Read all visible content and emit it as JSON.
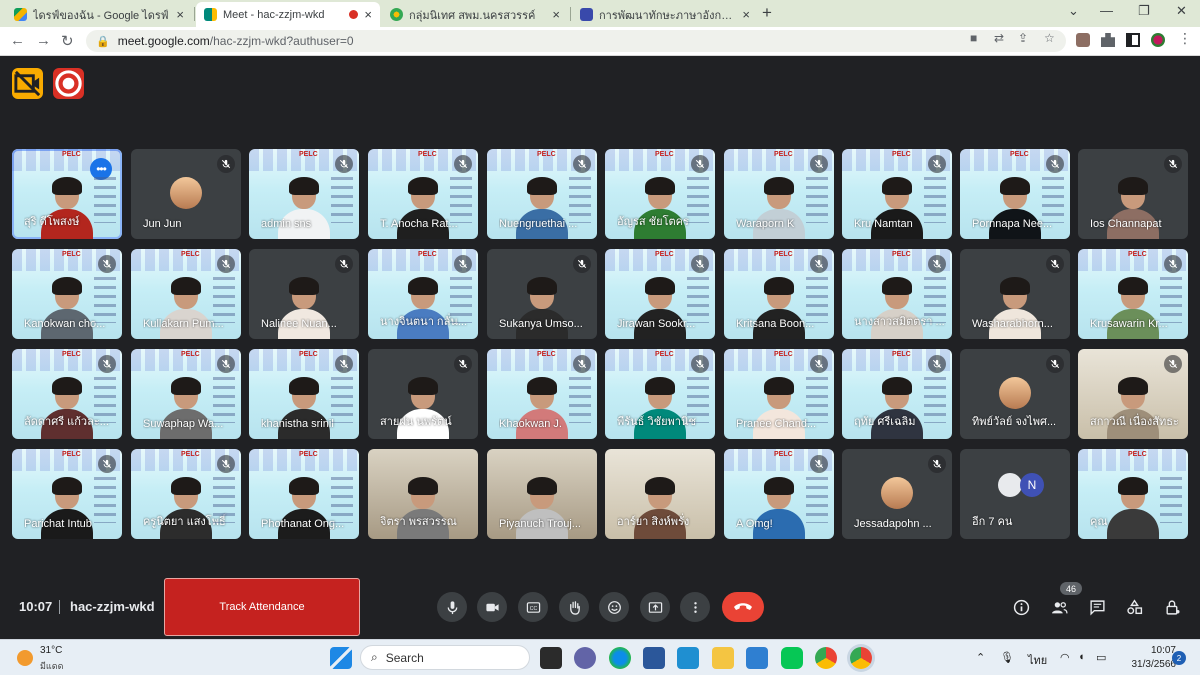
{
  "browser": {
    "tabs": [
      {
        "title": "ไดรฟ์ของฉัน - Google ไดรฟ์",
        "color": "#4285f4"
      },
      {
        "title": "Meet - hac-zzjm-wkd",
        "color": "#00897b"
      },
      {
        "title": "กลุ่มนิเทศ สพม.นครสวรรค์",
        "color": "#34a853"
      },
      {
        "title": "การพัฒนาทักษะภาษาอังกฤษ English",
        "color": "#3949ab"
      }
    ],
    "new_tab": "+",
    "url_host": "meet.google.com",
    "url_path": "/hac-zzjm-wkd?authuser=0"
  },
  "meeting": {
    "code": "hac-zzjm-wkd",
    "time": "10:07",
    "track_attendance": "Track Attendance",
    "people_count": "46",
    "tiles": [
      {
        "name": "สุริ ดีโพสงษ์",
        "kind": "slide",
        "mute": false,
        "dots": true,
        "selected": true,
        "body": "#b3261e"
      },
      {
        "name": "Jun Jun",
        "kind": "dark",
        "mute": true,
        "avatar": true
      },
      {
        "name": "admin sns",
        "kind": "slide",
        "mute": true,
        "body": "#f1f3f4"
      },
      {
        "name": "T. Anocha Rat...",
        "kind": "slide",
        "mute": true,
        "body": "#1f1f1f"
      },
      {
        "name": "Nuengruethai ...",
        "kind": "slide",
        "mute": true,
        "body": "#3a6ea5"
      },
      {
        "name": "อัญรส ชัยโตคร",
        "kind": "slide",
        "mute": true,
        "body": "#2e7d32"
      },
      {
        "name": "Waraporn K",
        "kind": "slide",
        "mute": true,
        "body": "#c2cfd6"
      },
      {
        "name": "Kru Namtan",
        "kind": "slide",
        "mute": true,
        "body": "#1a1a1a"
      },
      {
        "name": "Pornnapa Nee...",
        "kind": "slide",
        "mute": true,
        "body": "#101418"
      },
      {
        "name": "Ios Channapat",
        "kind": "dark",
        "mute": true,
        "body": "#8d6e63"
      },
      {
        "name": "Kanokwan cho...",
        "kind": "slide",
        "mute": true,
        "body": "#5d6770"
      },
      {
        "name": "Kullakarn Pum...",
        "kind": "slide",
        "mute": true,
        "body": "#d9d4cf"
      },
      {
        "name": "Nalinee Nuan...",
        "kind": "dark",
        "mute": true,
        "body": "#f0e8e0"
      },
      {
        "name": "นางจินตนา กลั่น...",
        "kind": "slide",
        "mute": true,
        "body": "#4a7cc1"
      },
      {
        "name": "Sukanya Umso...",
        "kind": "dark",
        "mute": true,
        "body": "#2b2b2b"
      },
      {
        "name": "Jirawan Sookr...",
        "kind": "slide",
        "mute": true,
        "body": "#222222"
      },
      {
        "name": "Kritsana Boon...",
        "kind": "slide",
        "mute": true,
        "body": "#222222"
      },
      {
        "name": "นางสาวสมิตตรา ...",
        "kind": "slide",
        "mute": true,
        "body": "#d6d0c8"
      },
      {
        "name": "Washarabhorn...",
        "kind": "dark",
        "mute": true,
        "body": "#efe6dc"
      },
      {
        "name": "Krusawarin Kr...",
        "kind": "slide",
        "mute": true,
        "body": "#6b8f5a"
      },
      {
        "name": "ลัดดาศรี แก้วละ...",
        "kind": "slide",
        "mute": true,
        "body": "#5f2f2f"
      },
      {
        "name": "Suwaphap Wa...",
        "kind": "slide",
        "mute": true,
        "body": "#6d6d6d"
      },
      {
        "name": "khanistha srinil",
        "kind": "slide",
        "mute": true,
        "body": "#2b2b2b"
      },
      {
        "name": "สายฝน นพรัตน์",
        "kind": "dark",
        "mute": true,
        "body": "#ffffff"
      },
      {
        "name": "Khaokwan J.",
        "kind": "slide",
        "mute": true,
        "body": "#d27a7a"
      },
      {
        "name": "พีรันธ์ วิชัยพานิช",
        "kind": "slide",
        "mute": true,
        "body": "#00897b"
      },
      {
        "name": "Pranee Chand...",
        "kind": "slide",
        "mute": true,
        "body": "#f3e6dc"
      },
      {
        "name": "ฤทัย ศรีเฉลิม",
        "kind": "slide",
        "mute": true,
        "body": "#2f3440"
      },
      {
        "name": "ทิพย์วัลย์ จงไพศ...",
        "kind": "dark",
        "mute": true,
        "avatar": true
      },
      {
        "name": "สกาวณี เนื่องสัทธะ",
        "kind": "warm",
        "mute": true,
        "body": "#9e8f7a"
      },
      {
        "name": "Parichat Intub",
        "kind": "slide",
        "mute": true,
        "body": "#1a1a1a"
      },
      {
        "name": "ครูนิตยา แสงโพธิ์",
        "kind": "slide",
        "mute": true,
        "body": "#2c2c2c"
      },
      {
        "name": "Phothanat Ong...",
        "kind": "slide",
        "mute": false,
        "body": "#1c1c1c"
      },
      {
        "name": "จิตรา พรสวรรณ",
        "kind": "photo",
        "mute": false,
        "body": "#7a7a7a"
      },
      {
        "name": "Piyanuch Trouj...",
        "kind": "photo",
        "mute": false,
        "body": "#bfbfbf"
      },
      {
        "name": "อาร์ยา สิงห์พรั่ง",
        "kind": "warm",
        "mute": false,
        "body": "#6e4b3a"
      },
      {
        "name": "A Omg!",
        "kind": "slide",
        "mute": true,
        "body": "#2b6cb0"
      },
      {
        "name": "Jessadapohn ...",
        "kind": "dark",
        "mute": true,
        "avatar": true
      },
      {
        "name": "อีก 7 คน",
        "kind": "dark",
        "mute": false,
        "others": true
      },
      {
        "name": "คุณ",
        "kind": "slide",
        "mute": false,
        "body": "#3a3a3a"
      }
    ]
  },
  "taskbar": {
    "temp": "31°C",
    "weather": "มีแดด",
    "search_label": "Search",
    "lang": "ไทย",
    "time": "10:07",
    "date": "31/3/2566",
    "notifications": "2"
  }
}
